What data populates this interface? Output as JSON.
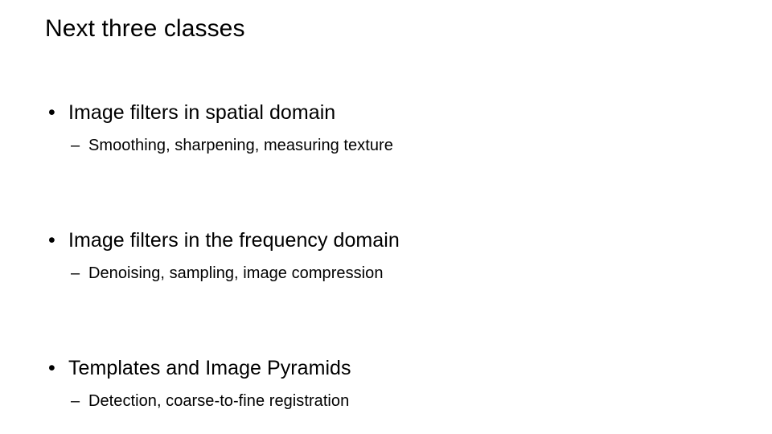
{
  "slide": {
    "title": "Next three classes",
    "background_color": "#ffffff",
    "text_color": "#000000",
    "bullet_marker": "•",
    "subbullet_marker": "–",
    "items": [
      {
        "bullet": "Image filters in spatial domain",
        "sub": "Smoothing, sharpening, measuring texture"
      },
      {
        "bullet": "Image filters in the frequency domain",
        "sub": "Denoising, sampling, image compression"
      },
      {
        "bullet": "Templates and Image Pyramids",
        "sub": "Detection, coarse-to-fine registration"
      }
    ]
  }
}
